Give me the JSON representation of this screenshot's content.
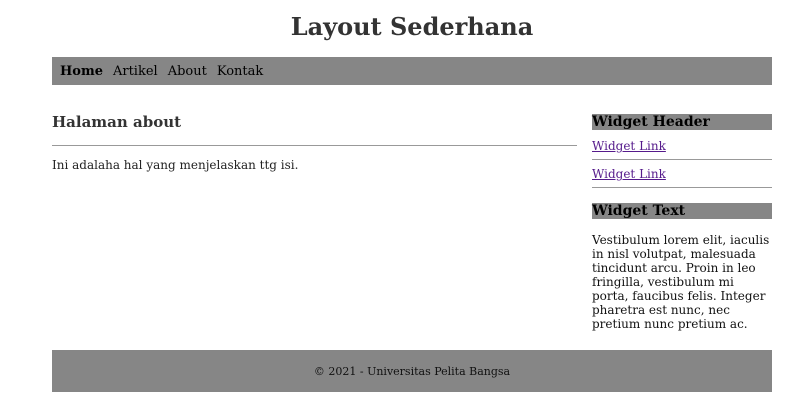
{
  "header": {
    "title": "Layout Sederhana"
  },
  "nav": {
    "items": [
      {
        "label": "Home",
        "active": true
      },
      {
        "label": "Artikel",
        "active": false
      },
      {
        "label": "About",
        "active": false
      },
      {
        "label": "Kontak",
        "active": false
      }
    ]
  },
  "main": {
    "title": "Halaman about",
    "text": "Ini adalaha hal yang menjelaskan ttg isi."
  },
  "sidebar": {
    "widget_header": "Widget Header",
    "links": [
      "Widget Link",
      "Widget Link"
    ],
    "widget_text_title": "Widget Text",
    "widget_text_body": "Vestibulum lorem elit, iaculis in nisl volutpat, malesuada tincidunt arcu. Proin in leo fringilla, vestibulum mi porta, faucibus felis. Integer pharetra est nunc, nec pretium nunc pretium ac."
  },
  "footer": {
    "text": "© 2021 - Universitas Pelita Bangsa"
  },
  "colors": {
    "nav_bg": "#868686",
    "footer_bg": "#868686",
    "link_visited": "#551a8b"
  }
}
